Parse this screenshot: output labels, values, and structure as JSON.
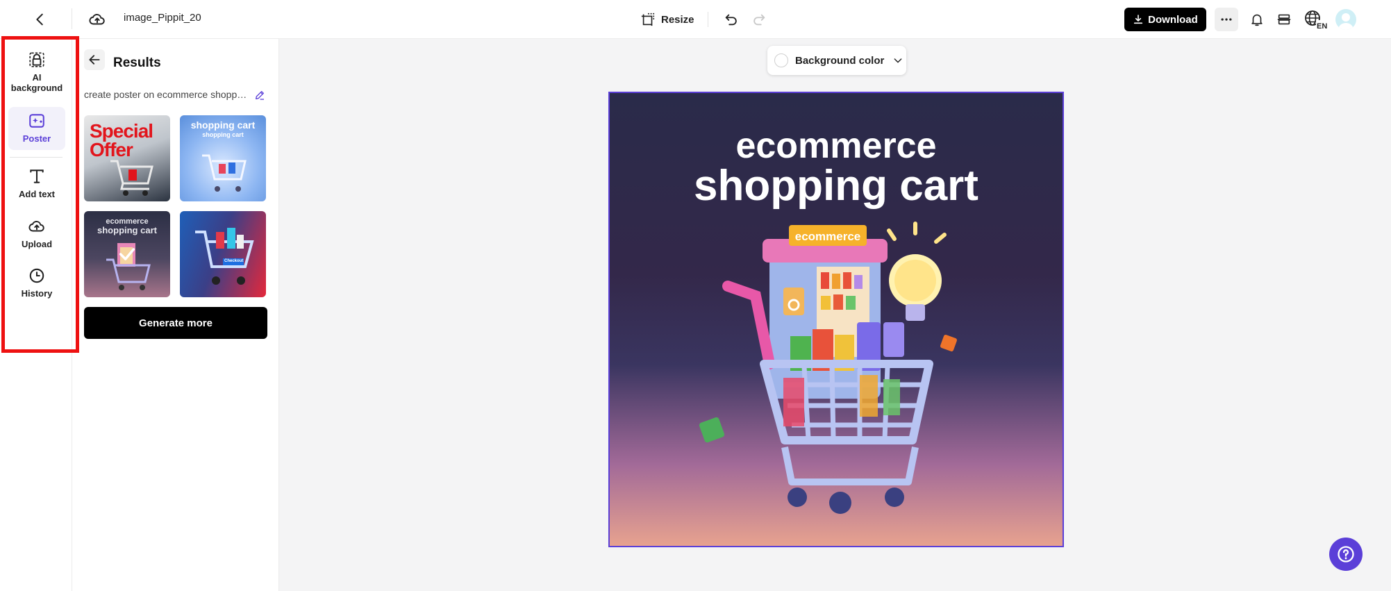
{
  "topbar": {
    "doc_title": "image_Pippit_20",
    "resize_label": "Resize",
    "download_label": "Download",
    "language_code": "EN"
  },
  "rail": {
    "items": [
      {
        "label": "AI background",
        "icon": "ai-background-icon",
        "active": false
      },
      {
        "label": "Poster",
        "icon": "poster-icon",
        "active": true
      },
      {
        "label": "Add text",
        "icon": "text-icon",
        "active": false
      },
      {
        "label": "Upload",
        "icon": "upload-icon",
        "active": false
      },
      {
        "label": "History",
        "icon": "history-icon",
        "active": false
      }
    ]
  },
  "panel": {
    "title": "Results",
    "prompt": "create poster on ecommerce shopping cart",
    "thumbnails": [
      {
        "text": "Special Offer"
      },
      {
        "text": "shopping cart",
        "subtext": "shopping cart"
      },
      {
        "text": "ecommerce",
        "subtext": "shopping cart",
        "selected": true
      },
      {
        "text": "",
        "tag": "Checkout"
      }
    ],
    "generate_label": "Generate more"
  },
  "canvas": {
    "background_color_label": "Background color",
    "poster_line1": "ecommerce",
    "poster_line2": "shopping cart",
    "shelf_sign": "ecommerce"
  },
  "colors": {
    "accent": "#5b3fd8",
    "highlight": "#ee1111"
  }
}
